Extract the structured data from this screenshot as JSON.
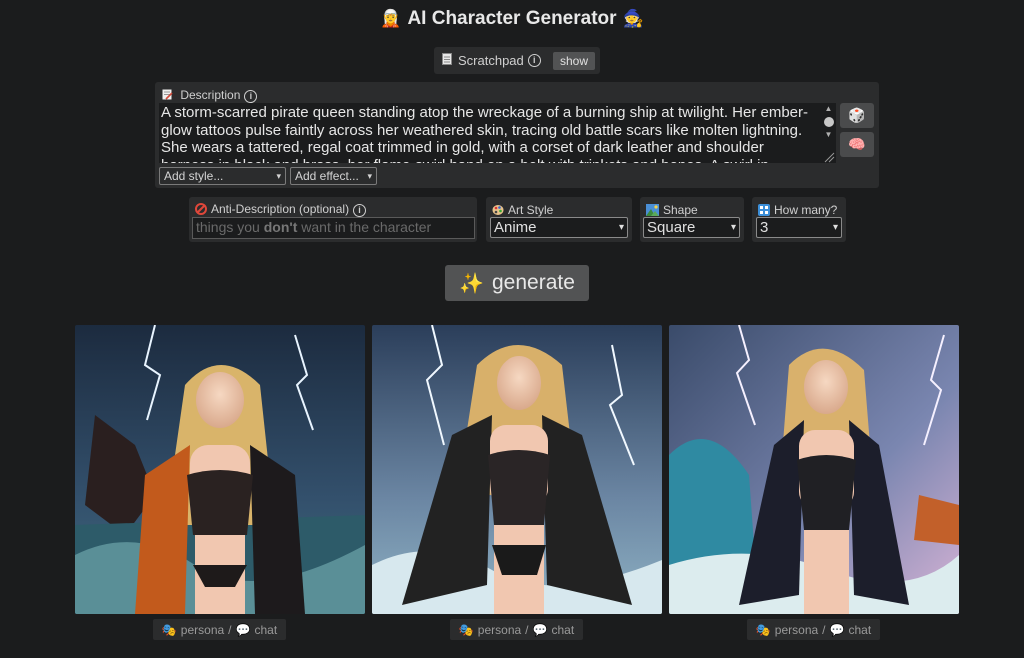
{
  "header": {
    "title": "AI Character Generator",
    "left_emoji": "🧝",
    "right_emoji": "🧙"
  },
  "scratchpad": {
    "label": "Scratchpad",
    "info": "i",
    "show_label": "show"
  },
  "description": {
    "label": "Description",
    "info": "i",
    "text": "A storm-scarred pirate queen standing atop the wreckage of a burning ship at twilight. Her ember-glow tattoos pulse faintly across her weathered skin, tracing old battle scars like molten lightning. She wears a tattered, regal coat trimmed in gold, with a corset of dark leather and shoulder harness in black and brass, her flame-swirl hand on a belt with trinkets and bones. A swirl in",
    "add_style": "Add style...",
    "add_effect": "Add effect...",
    "random_icon": "🎲",
    "brain_icon": "🧠"
  },
  "anti": {
    "label": "Anti-Description (optional)",
    "info": "i",
    "placeholder_pre": "things you ",
    "placeholder_bold": "don't",
    "placeholder_post": " want in the character"
  },
  "art_style": {
    "label": "Art Style",
    "value": "Anime"
  },
  "shape": {
    "label": "Shape",
    "value": "Square"
  },
  "how_many": {
    "label": "How many?",
    "value": "3"
  },
  "generate": {
    "label": "generate",
    "icon": "✨"
  },
  "results": [
    {
      "persona": "persona",
      "sep": "/",
      "chat": "chat"
    },
    {
      "persona": "persona",
      "sep": "/",
      "chat": "chat"
    },
    {
      "persona": "persona",
      "sep": "/",
      "chat": "chat"
    }
  ]
}
